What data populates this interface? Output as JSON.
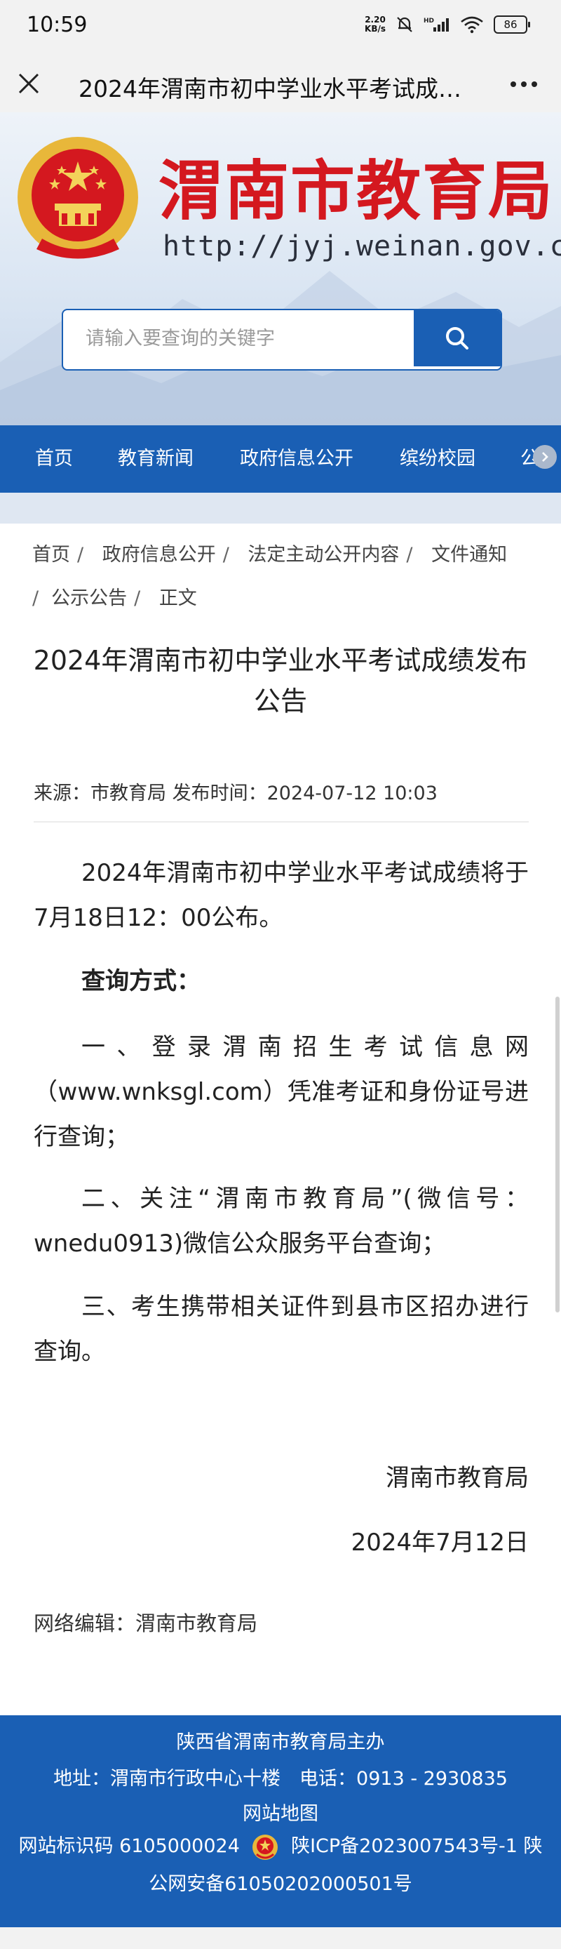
{
  "status_bar": {
    "time": "10:59",
    "net_speed_value": "2.20",
    "net_speed_unit": "KB/s",
    "battery": "86"
  },
  "browser": {
    "title": "2024年渭南市初中学业水平考试成…",
    "close_icon": "close-icon",
    "more_icon": "more-icon"
  },
  "banner": {
    "site_name": "渭南市教育局",
    "url": "http://jyj.weinan.gov.cn",
    "search_placeholder": "请输入要查询的关键字",
    "colors": {
      "brand_red": "#d4181f",
      "brand_blue": "#1a5fb4"
    }
  },
  "nav": {
    "items": [
      {
        "label": "首页"
      },
      {
        "label": "教育新闻"
      },
      {
        "label": "政府信息公开"
      },
      {
        "label": "缤纷校园"
      },
      {
        "label": "公"
      }
    ]
  },
  "breadcrumb": {
    "items": [
      "首页",
      "政府信息公开",
      "法定主动公开内容",
      "文件通知",
      "公示公告",
      "正文"
    ],
    "separator": "/"
  },
  "article": {
    "title": "2024年渭南市初中学业水平考试成绩发布公告",
    "meta": "来源：市教育局  发布时间：2024-07-12 10:03",
    "paragraphs": [
      "2024年渭南市初中学业水平考试成绩将于7月18日12：00公布。",
      "查询方式：",
      "一、登录渭南招生考试信息网（www.wnksgl.com）凭准考证和身份证号进行查询；",
      "二、关注“渭南市教育局”(微信号：wnedu0913)微信公众服务平台查询；",
      "三、考生携带相关证件到县市区招办进行查询。"
    ],
    "signature": "渭南市教育局",
    "date": "2024年7月12日",
    "editor": "网络编辑：渭南市教育局"
  },
  "footer": {
    "sponsor": "陕西省渭南市教育局主办",
    "address": "地址：渭南市行政中心十楼　电话：0913 - 2930835",
    "sitemap": "网站地图",
    "site_id": "网站标识码 6105000024",
    "icp": "陕ICP备2023007543号-1 陕",
    "police": "公网安备61050202000501号"
  }
}
